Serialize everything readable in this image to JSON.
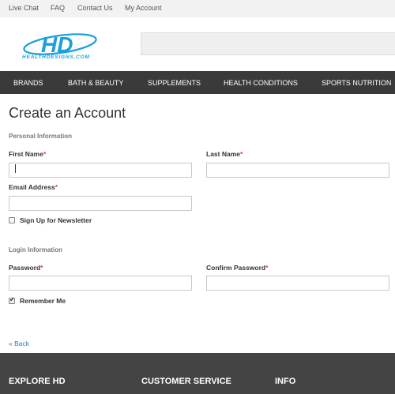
{
  "topbar": {
    "links": [
      "Live Chat",
      "FAQ",
      "Contact Us",
      "My Account"
    ]
  },
  "brand": {
    "logo_letters": "HD",
    "logo_text": "HEALTHDESIGNS.COM",
    "color": "#1a9fe0"
  },
  "nav": {
    "items": [
      "BRANDS",
      "BATH & BEAUTY",
      "SUPPLEMENTS",
      "HEALTH CONDITIONS",
      "SPORTS NUTRITION"
    ]
  },
  "page": {
    "title": "Create an Account"
  },
  "form": {
    "personal_heading": "Personal Information",
    "first_name_label": "First Name",
    "last_name_label": "Last Name",
    "email_label": "Email Address",
    "newsletter_label": "Sign Up for Newsletter",
    "login_heading": "Login Information",
    "password_label": "Password",
    "confirm_password_label": "Confirm Password",
    "remember_label": "Remember Me",
    "required_mark": "*",
    "first_name_value": "",
    "last_name_value": "",
    "email_value": "",
    "password_value": "",
    "confirm_password_value": "",
    "newsletter_checked": false,
    "remember_checked": true
  },
  "back_link": "« Back",
  "footer": {
    "headings": [
      "EXPLORE HD",
      "CUSTOMER SERVICE",
      "INFO"
    ]
  },
  "colors": {
    "nav_bg": "#3a3a3a",
    "footer_bg": "#444444",
    "required": "#e0443a",
    "link": "#2a7cc7"
  }
}
